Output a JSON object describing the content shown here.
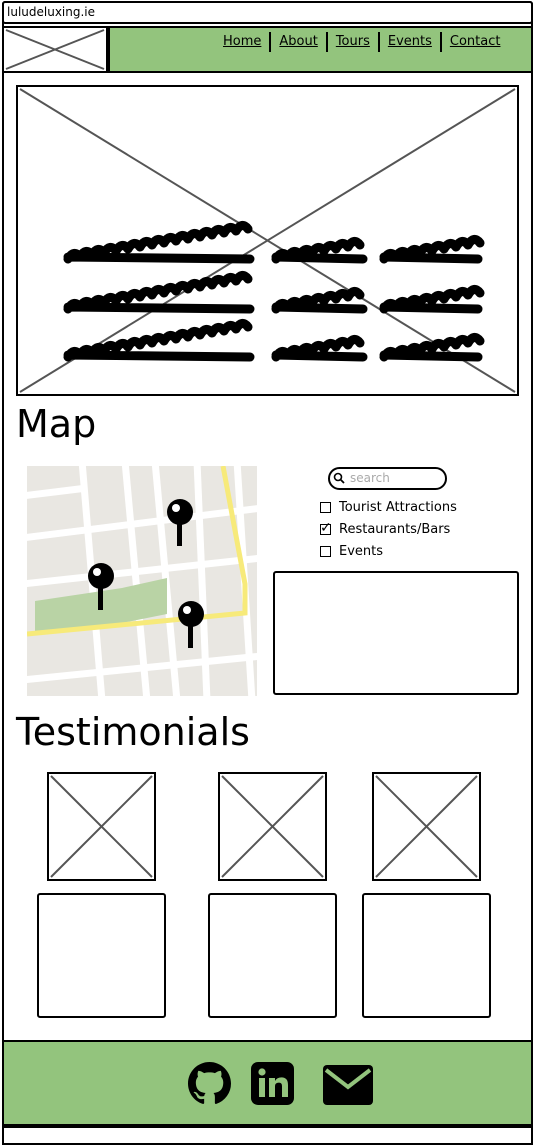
{
  "browser": {
    "url": "luludeluxing.ie"
  },
  "nav": {
    "links": [
      "Home",
      "About",
      "Tours",
      "Events",
      "Contact"
    ]
  },
  "sections": {
    "map_title": "Map",
    "testimonials_title": "Testimonials"
  },
  "map_panel": {
    "search_placeholder": "search",
    "filters": [
      {
        "label": "Tourist Attractions",
        "checked": false
      },
      {
        "label": "Restaurants/Bars",
        "checked": true
      },
      {
        "label": "Events",
        "checked": false
      }
    ]
  },
  "footer": {
    "icons": [
      "github-icon",
      "linkedin-icon",
      "email-icon"
    ]
  },
  "colors": {
    "nav_bg": "#93c47d",
    "footer_bg": "#93c47d"
  }
}
